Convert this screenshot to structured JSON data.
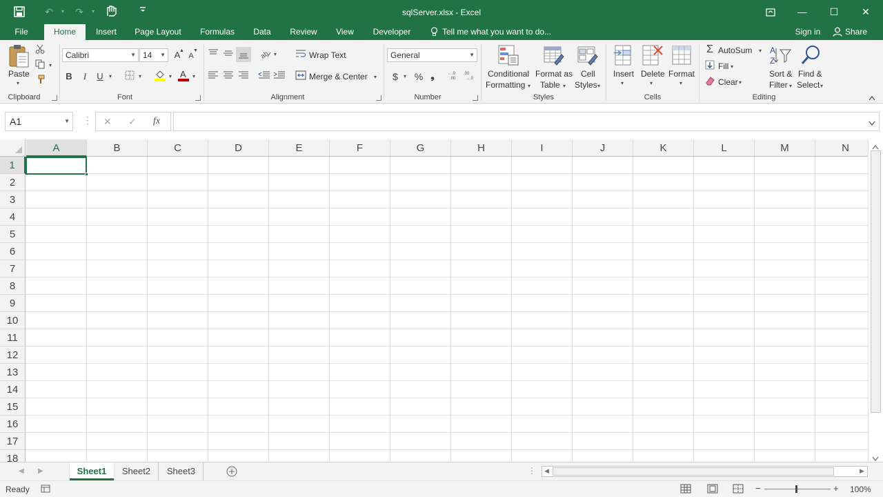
{
  "window": {
    "title": "sqlServer.xlsx - Excel",
    "accent": "#217346",
    "controls": {
      "ribbon_display": "▣",
      "minimize": "—",
      "maximize": "☐",
      "close": "✕"
    }
  },
  "quick_access": {
    "save": "🖫",
    "undo": "↶",
    "redo": "↷",
    "touch": "☝",
    "customize": "▾"
  },
  "tabs": [
    {
      "label": "File"
    },
    {
      "label": "Home"
    },
    {
      "label": "Insert"
    },
    {
      "label": "Page Layout"
    },
    {
      "label": "Formulas"
    },
    {
      "label": "Data"
    },
    {
      "label": "Review"
    },
    {
      "label": "View"
    },
    {
      "label": "Developer"
    }
  ],
  "tell_me": "Tell me what you want to do...",
  "sign_in": "Sign in",
  "share": "Share",
  "ribbon": {
    "clipboard": {
      "label": "Clipboard",
      "paste": "Paste"
    },
    "font": {
      "label": "Font",
      "name": "Calibri",
      "size": "14",
      "bold": "B",
      "italic": "I",
      "underline": "U",
      "grow": "A",
      "shrink": "A"
    },
    "alignment": {
      "label": "Alignment",
      "wrap_text": "Wrap Text",
      "merge_center": "Merge & Center"
    },
    "number": {
      "label": "Number",
      "format": "General",
      "currency": "$",
      "percent": "%",
      "comma": "❟"
    },
    "styles": {
      "label": "Styles",
      "conditional_1": "Conditional",
      "conditional_2": "Formatting",
      "format_as_1": "Format as",
      "format_as_2": "Table",
      "cell_styles_1": "Cell",
      "cell_styles_2": "Styles"
    },
    "cells": {
      "label": "Cells",
      "insert": "Insert",
      "delete": "Delete",
      "format": "Format"
    },
    "editing": {
      "label": "Editing",
      "autosum": "AutoSum",
      "fill": "Fill",
      "clear": "Clear",
      "sort_1": "Sort &",
      "sort_2": "Filter",
      "find_1": "Find &",
      "find_2": "Select"
    }
  },
  "formula_bar": {
    "name_box": "A1",
    "cancel": "✕",
    "enter": "✓",
    "fx": "fx",
    "value": ""
  },
  "grid": {
    "columns": [
      "A",
      "B",
      "C",
      "D",
      "E",
      "F",
      "G",
      "H",
      "I",
      "J",
      "K",
      "L",
      "M",
      "N"
    ],
    "rows": [
      "1",
      "2",
      "3",
      "4",
      "5",
      "6",
      "7",
      "8",
      "9",
      "10",
      "11",
      "12",
      "13",
      "14",
      "15",
      "16",
      "17",
      "18"
    ],
    "selected_cell": "A1"
  },
  "sheets": [
    {
      "label": "Sheet1"
    },
    {
      "label": "Sheet2"
    },
    {
      "label": "Sheet3"
    }
  ],
  "status": {
    "ready": "Ready",
    "zoom": "100%"
  }
}
